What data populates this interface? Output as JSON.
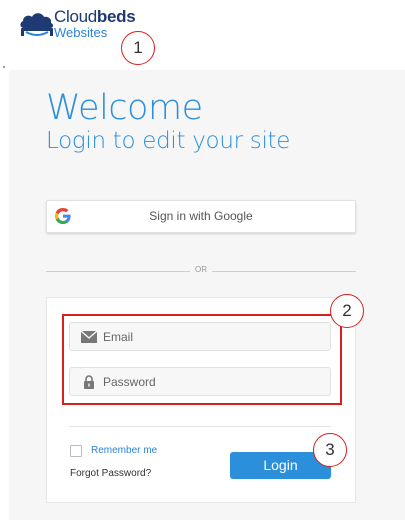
{
  "logo": {
    "line1_regular": "Cloud",
    "line1_bold": "beds",
    "line2": "Websites"
  },
  "header": {
    "welcome": "Welcome",
    "subtitle": "Login to edit your site"
  },
  "google": {
    "label": "Sign in with Google",
    "icon": "google-icon"
  },
  "divider": {
    "text": "OR"
  },
  "form": {
    "email": {
      "placeholder": "Email",
      "value": "",
      "icon": "envelope-icon"
    },
    "password": {
      "placeholder": "Password",
      "value": "",
      "icon": "lock-icon"
    },
    "remember_label": "Remember me",
    "remember_checked": false,
    "forgot_label": "Forgot Password?",
    "login_label": "Login"
  },
  "annotations": [
    "1",
    "2",
    "3"
  ],
  "colors": {
    "accent": "#2b8fdb",
    "brand_dark": "#1f3a73",
    "annotation_red": "#d81e1e"
  }
}
